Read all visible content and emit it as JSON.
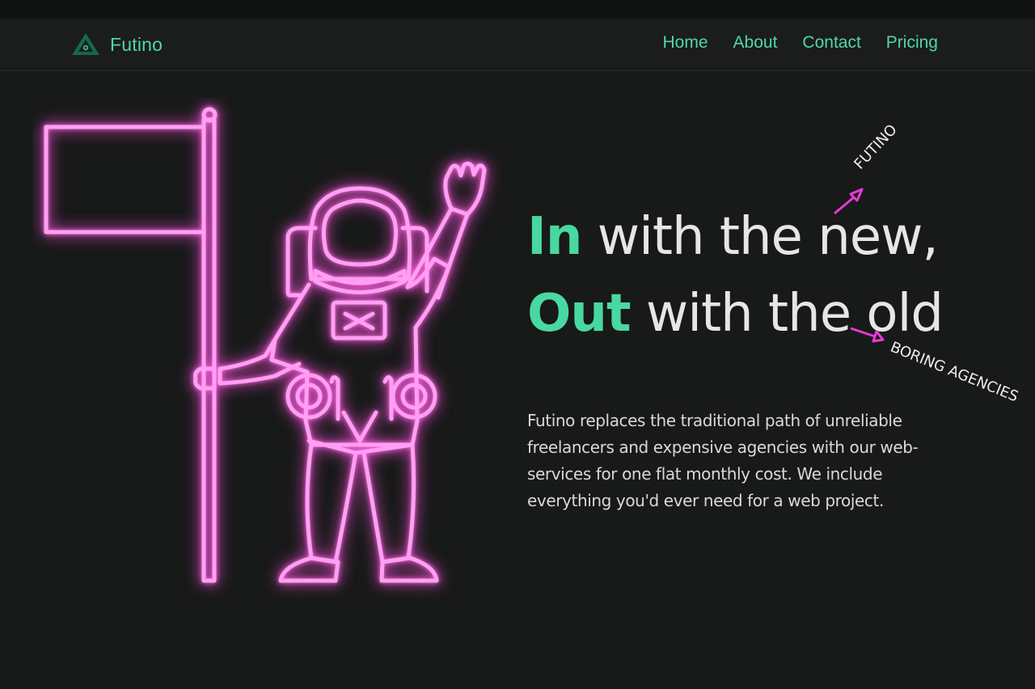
{
  "nav": {
    "brand_name": "Futino",
    "links": [
      {
        "label": "Home"
      },
      {
        "label": "About"
      },
      {
        "label": "Contact"
      },
      {
        "label": "Pricing"
      }
    ]
  },
  "hero": {
    "line1_accent": "In",
    "line1_rest": " with the new,",
    "line2_accent": "Out",
    "line2_rest": " with the old",
    "annotation_top": "FUTINO",
    "annotation_bottom": "BORING AGENCIES",
    "description": "Futino replaces the traditional path of unreliable freelancers and expensive agencies with our web-services for one flat monthly cost. We include everything you'd ever need for a web project."
  },
  "colors": {
    "accent": "#4fd8a4",
    "neon": "#ff8ef0",
    "arrow": "#e63ad8",
    "background": "#181919"
  },
  "icons": {
    "logo": "triangle-logo-icon",
    "illustration": "neon-astronaut-flag",
    "arrows": "arrow-icon"
  }
}
